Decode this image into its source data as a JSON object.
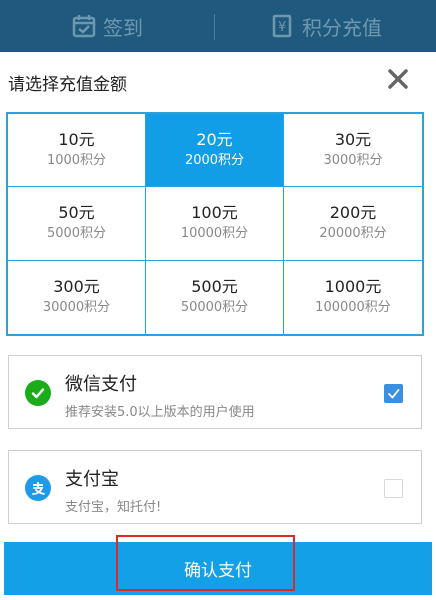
{
  "topbar": {
    "tabs": [
      {
        "label": "签到",
        "icon": "calendar-check-icon"
      },
      {
        "label": "积分充值",
        "icon": "money-document-icon"
      }
    ]
  },
  "sheet": {
    "title": "请选择充值金额",
    "close_icon": "close-icon"
  },
  "amounts": [
    {
      "amount": "10元",
      "points": "1000积分",
      "selected": false
    },
    {
      "amount": "20元",
      "points": "2000积分",
      "selected": true
    },
    {
      "amount": "30元",
      "points": "3000积分",
      "selected": false
    },
    {
      "amount": "50元",
      "points": "5000积分",
      "selected": false
    },
    {
      "amount": "100元",
      "points": "10000积分",
      "selected": false
    },
    {
      "amount": "200元",
      "points": "20000积分",
      "selected": false
    },
    {
      "amount": "300元",
      "points": "30000积分",
      "selected": false
    },
    {
      "amount": "500元",
      "points": "50000积分",
      "selected": false
    },
    {
      "amount": "1000元",
      "points": "100000积分",
      "selected": false
    }
  ],
  "payment": {
    "wechat": {
      "name": "微信支付",
      "desc": "推荐安装5.0以上版本的用户使用",
      "checked": true,
      "color": "#1aad19"
    },
    "alipay": {
      "name": "支付宝",
      "desc": "支付宝，知托付!",
      "checked": false,
      "color": "#1e9be8"
    }
  },
  "confirm_label": "确认支付",
  "colors": {
    "accent": "#14a0e6",
    "selected_cell": "#119ee6",
    "highlight": "#d92b2b",
    "topbar": "#1f5a7e"
  }
}
